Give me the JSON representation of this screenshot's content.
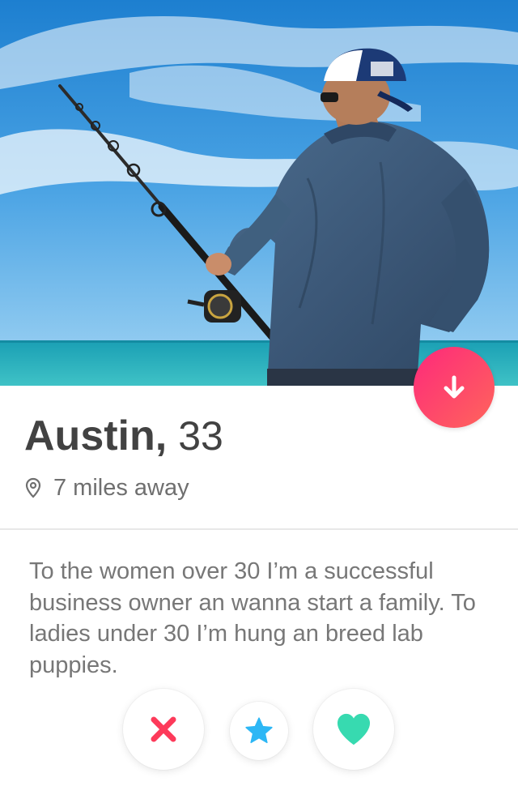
{
  "profile": {
    "name": "Austin",
    "comma": ",",
    "age": "33",
    "distance": "7 miles away",
    "bio": "To the women over 30 I’m a successful business owner an wanna start a family. To ladies under 30 I’m hung an breed lab puppies.",
    "faded_line": "",
    "photo_alt": ""
  },
  "icons": {
    "down_arrow": "arrow-down-icon",
    "location": "location-pin-icon",
    "nope": "x-icon",
    "super_like": "star-icon",
    "like": "heart-icon"
  },
  "colors": {
    "accent_gradient_start": "#fd297b",
    "accent_gradient_end": "#ff655b",
    "nope": "#fd3a5a",
    "super_like": "#2db7f5",
    "like": "#37dab0",
    "name_text": "#424242",
    "secondary_text": "#6f6f6f",
    "bio_text": "#777777"
  }
}
